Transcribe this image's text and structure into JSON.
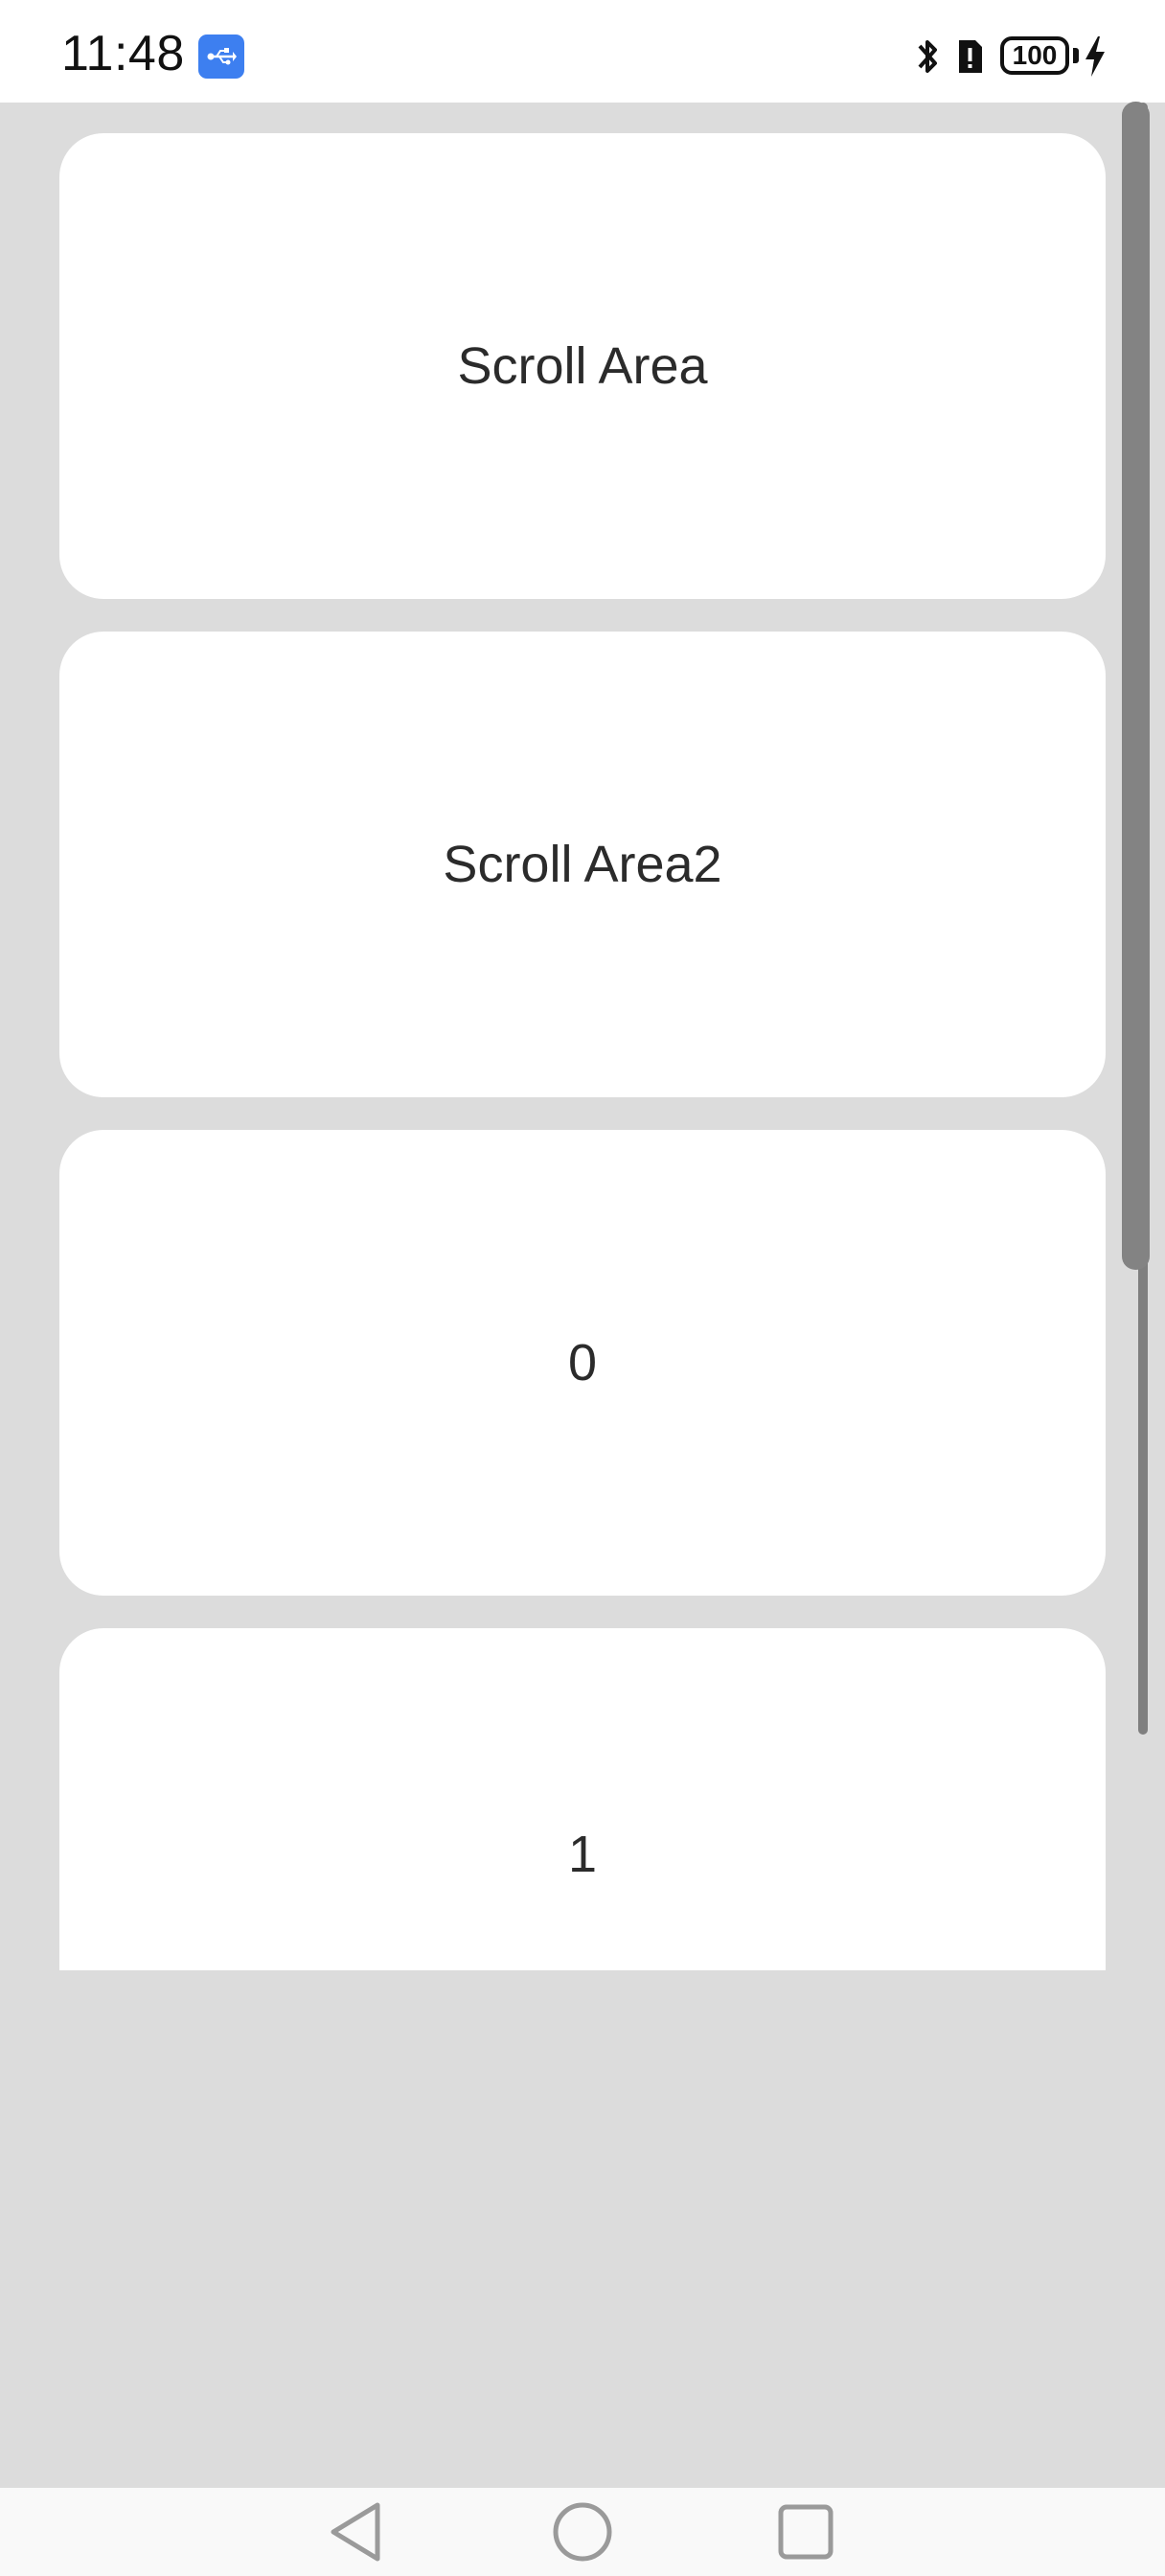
{
  "status_bar": {
    "time": "11:48",
    "battery_level": "100",
    "icons": [
      "usb-icon",
      "bluetooth-icon",
      "alert-icon",
      "battery-icon",
      "charging-icon"
    ]
  },
  "cards": [
    {
      "label": "Scroll Area"
    },
    {
      "label": "Scroll Area2"
    },
    {
      "label": "0"
    },
    {
      "label": "1"
    }
  ],
  "scroll": {
    "thumb_fraction": 0.45
  },
  "nav_bar": {
    "buttons": [
      "back-icon",
      "home-icon",
      "recent-apps-icon"
    ]
  },
  "colors": {
    "background": "#dcdcdc",
    "card": "#ffffff",
    "usb_badge": "#3d7ff0",
    "scrollbar": "#838383"
  }
}
